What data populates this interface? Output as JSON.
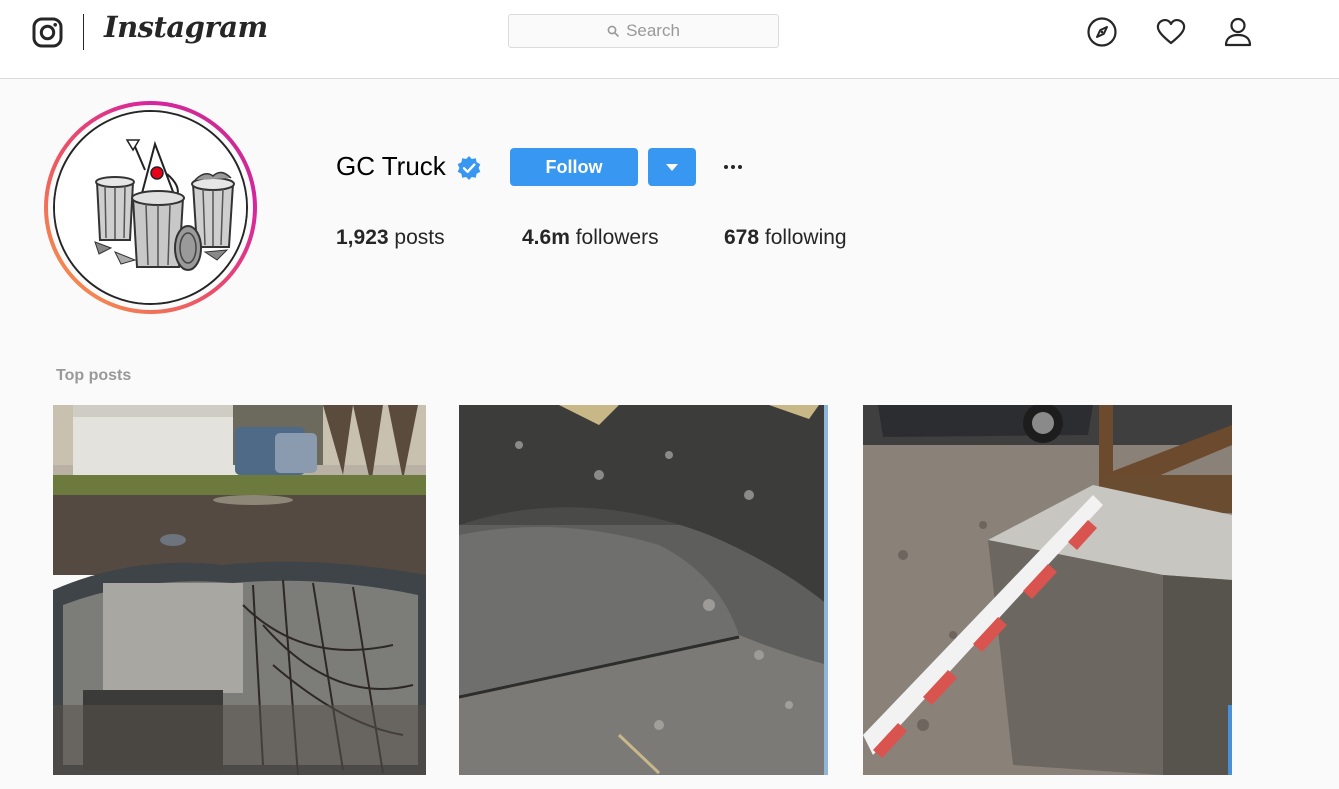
{
  "header": {
    "logo_text": "Instagram",
    "search_placeholder": "Search",
    "icons": [
      "camera-logo-icon",
      "compass-icon",
      "heart-icon",
      "person-icon"
    ]
  },
  "profile": {
    "username": "GC Truck",
    "verified": true,
    "follow_label": "Follow",
    "stats": {
      "posts_count": "1,923",
      "posts_label": "posts",
      "followers_count": "4.6m",
      "followers_label": "followers",
      "following_count": "678",
      "following_label": "following"
    }
  },
  "top_posts": {
    "title": "Top posts"
  },
  "colors": {
    "accent": "#3897f0",
    "verified": "#3897f0",
    "ring_start": "#f9a244",
    "ring_end": "#c13584",
    "background": "#fafafa"
  }
}
